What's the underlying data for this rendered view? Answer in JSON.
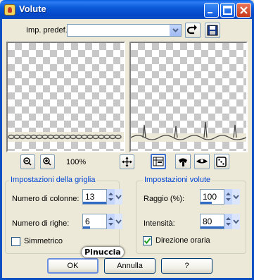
{
  "window": {
    "title": "Volute"
  },
  "preset": {
    "label": "Imp. predef.:",
    "value": ""
  },
  "zoom": {
    "value": "100%"
  },
  "grid_group": {
    "title": "Impostazioni della griglia",
    "columns_label": "Numero di colonne:",
    "columns_value": "13",
    "rows_label": "Numero di righe:",
    "rows_value": "6",
    "symmetric_label": "Simmetrico",
    "symmetric_checked": false
  },
  "volute_group": {
    "title": "Impostazioni volute",
    "radius_label": "Raggio (%):",
    "radius_value": "100",
    "intensity_label": "Intensità:",
    "intensity_value": "80",
    "clockwise_label": "Direzione oraria",
    "clockwise_checked": true
  },
  "buttons": {
    "ok": "OK",
    "cancel": "Annulla",
    "help": "?"
  },
  "watermark": {
    "text": "Pinuccia"
  },
  "colors": {
    "accent": "#0046d5",
    "titlebar": "#0a4fc4",
    "dialog_bg": "#ece9d8"
  },
  "icons": [
    "app-icon",
    "help-icon",
    "maximize-icon",
    "close-icon",
    "reset-icon",
    "save-icon",
    "zoom-out-icon",
    "zoom-in-icon",
    "pan-icon",
    "view-icon",
    "tool-icon",
    "eye-icon",
    "dice-icon"
  ]
}
